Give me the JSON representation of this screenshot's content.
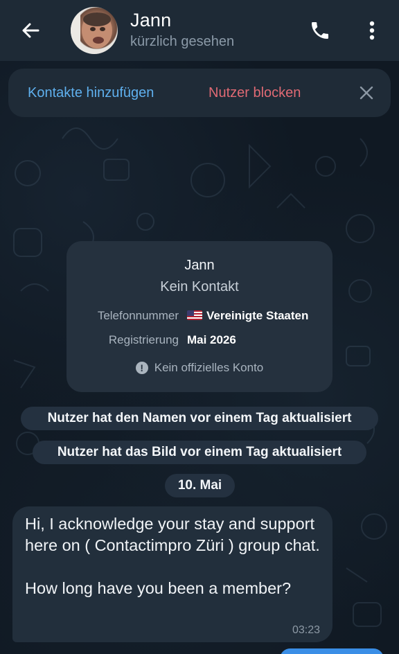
{
  "header": {
    "title": "Jann",
    "subtitle": "kürzlich gesehen"
  },
  "action_bar": {
    "add_contact": "Kontakte hinzufügen",
    "block_user": "Nutzer blocken"
  },
  "info_card": {
    "name": "Jann",
    "status": "Kein Kontakt",
    "phone_label": "Telefonnummer",
    "phone_value": "Vereinigte Staaten",
    "registration_label": "Registrierung",
    "registration_value": "Mai 2026",
    "official_note": "Kein offizielles Konto"
  },
  "service_messages": {
    "name_updated": "Nutzer hat den Namen vor einem Tag aktualisiert",
    "photo_updated": "Nutzer hat das Bild vor einem Tag aktualisiert",
    "date": "10. Mai"
  },
  "message": {
    "text": "Hi, I acknowledge your stay and support here on ( Contactimpro Züri ) group chat.\n\nHow long have you been a member?",
    "time": "03:23"
  },
  "colors": {
    "accent_blue": "#5fb0ee",
    "danger_red": "#e06a74",
    "header_bg": "#1e2a36",
    "bubble_bg": "#222f3c"
  },
  "icons": {
    "back": "arrow-left-icon",
    "call": "phone-icon",
    "more": "more-vertical-icon",
    "close": "close-icon",
    "info": "info-icon",
    "flag": "us-flag-icon"
  }
}
